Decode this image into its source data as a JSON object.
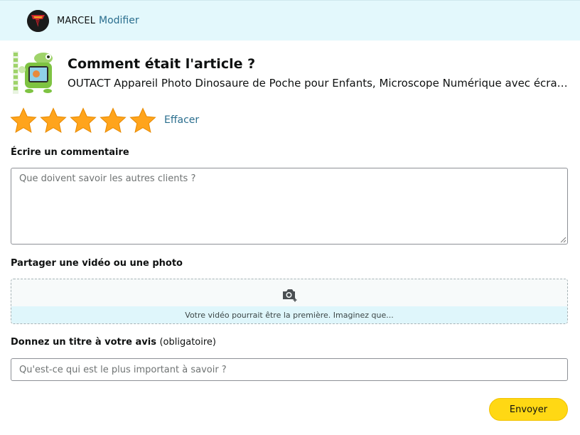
{
  "header": {
    "user_name": "MARCEL",
    "modify_label": "Modifier"
  },
  "product": {
    "question": "Comment était l'article ?",
    "title": "OUTACT Appareil Photo Dinosaure de Poche pour Enfants, Microscope Numérique avec écran L..."
  },
  "rating": {
    "value": 5,
    "max": 5,
    "star_color": "#ffa41c",
    "clear_label": "Effacer"
  },
  "comment": {
    "label": "Écrire un commentaire",
    "placeholder": "Que doivent savoir les autres clients ?",
    "value": ""
  },
  "media": {
    "label": "Partager une vidéo ou une photo",
    "icon": "camera-add-icon",
    "hint": "Votre vidéo pourrait être la première. Imaginez que..."
  },
  "review_title": {
    "label": "Donnez un titre à votre avis",
    "required_note": "(obligatoire)",
    "placeholder": "Qu'est-ce qui est le plus important à savoir ?",
    "value": ""
  },
  "submit": {
    "label": "Envoyer",
    "color": "#ffd814"
  },
  "colors": {
    "header_bg": "#e3f8fc",
    "link": "#2a6e8e"
  }
}
